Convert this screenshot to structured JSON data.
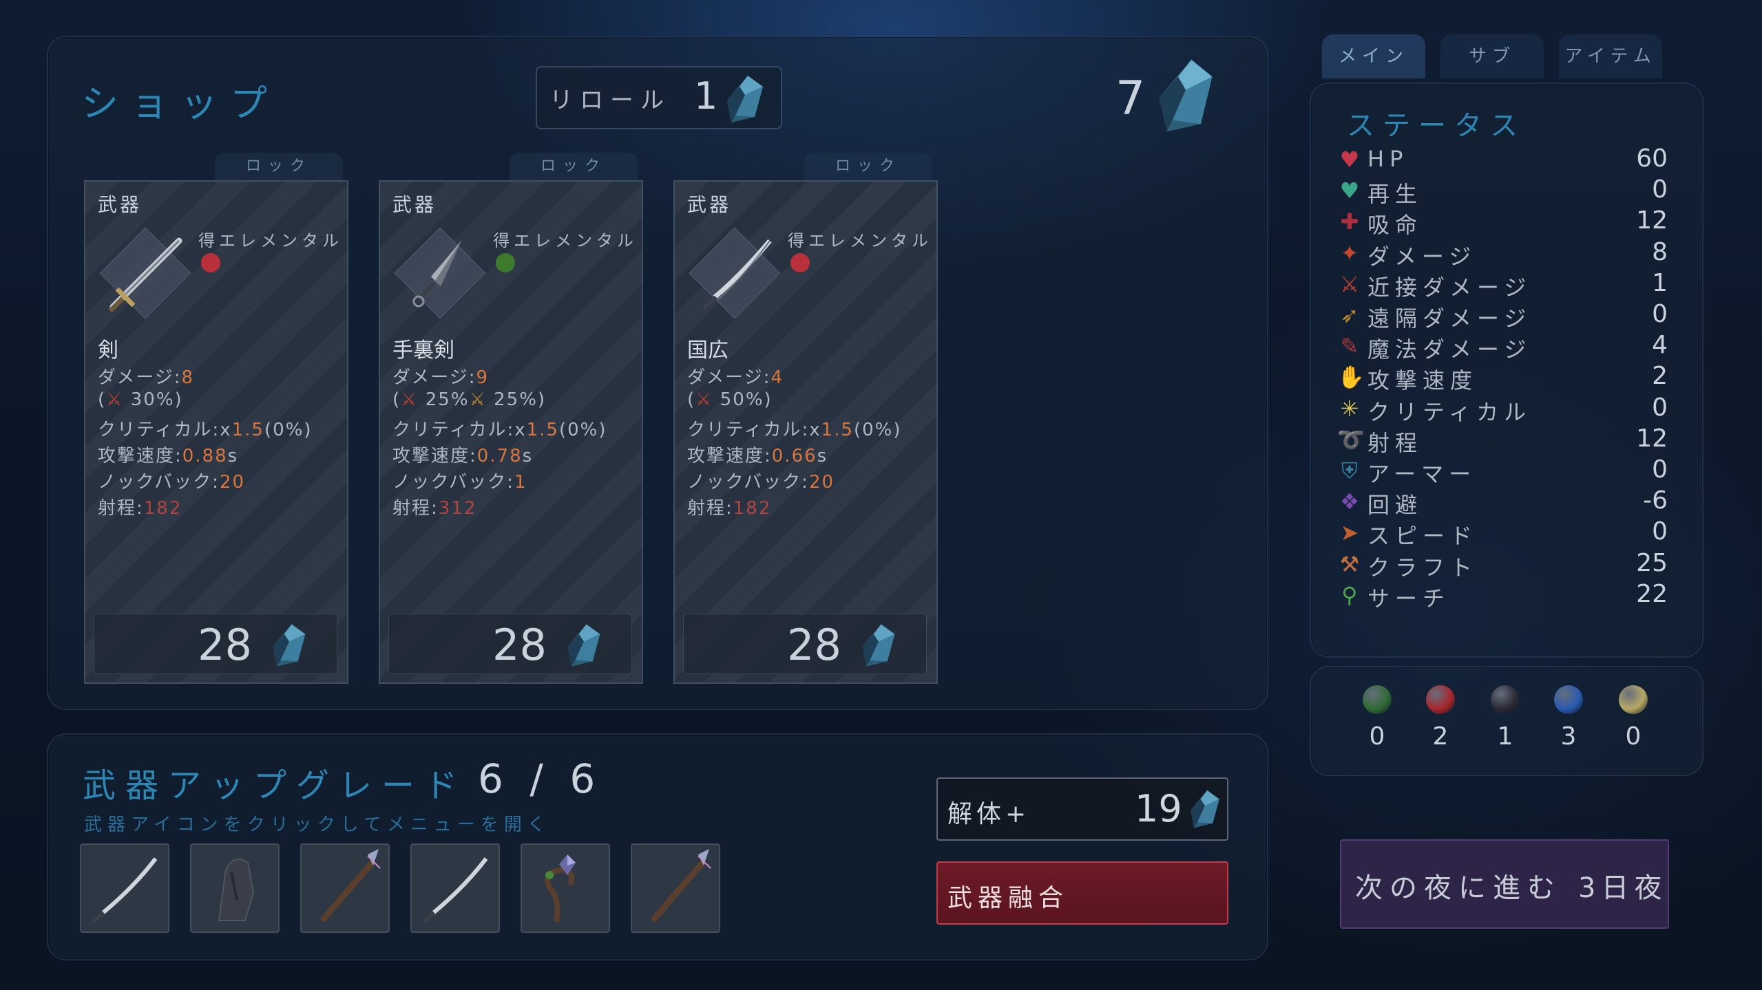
{
  "shop": {
    "title": "ショップ",
    "reroll_label": "リロール",
    "reroll_cost": "1",
    "money": "7"
  },
  "cards": [
    {
      "lock": "ロック",
      "category": "武器",
      "element_label": "得エレメンタル",
      "element_color": "#b8313a",
      "name": "剣",
      "damage_label": "ダメージ:",
      "damage": "8",
      "scaling_open": "(",
      "scaling": " 30%)",
      "crit_label": "クリティカル:",
      "crit_x": "x",
      "crit_mult": "1.5",
      "crit_pct": "(0%)",
      "speed_label": "攻撃速度:",
      "speed": "0.88",
      "speed_unit": "s",
      "knockback_label": "ノックバック:",
      "knockback": "20",
      "range_label": "射程:",
      "range": "182",
      "price": "28"
    },
    {
      "lock": "ロック",
      "category": "武器",
      "element_label": "得エレメンタル",
      "element_color": "#3c7a2e",
      "name": "手裏剣",
      "damage_label": "ダメージ:",
      "damage": "9",
      "scaling_open": "(",
      "scaling": " 25%",
      "scaling2": " 25%)",
      "crit_label": "クリティカル:",
      "crit_x": "x",
      "crit_mult": "1.5",
      "crit_pct": "(0%)",
      "speed_label": "攻撃速度:",
      "speed": "0.78",
      "speed_unit": "s",
      "knockback_label": "ノックバック:",
      "knockback": "1",
      "range_label": "射程:",
      "range": "312",
      "price": "28"
    },
    {
      "lock": "ロック",
      "category": "武器",
      "element_label": "得エレメンタル",
      "element_color": "#b8313a",
      "name": "国広",
      "damage_label": "ダメージ:",
      "damage": "4",
      "scaling_open": "(",
      "scaling": " 50%)",
      "crit_label": "クリティカル:",
      "crit_x": "x",
      "crit_mult": "1.5",
      "crit_pct": "(0%)",
      "speed_label": "攻撃速度:",
      "speed": "0.66",
      "speed_unit": "s",
      "knockback_label": "ノックバック:",
      "knockback": "20",
      "range_label": "射程:",
      "range": "182",
      "price": "28"
    }
  ],
  "tabs": [
    "メイン",
    "サブ",
    "アイテム"
  ],
  "status": {
    "title": "ステータス",
    "rows": [
      {
        "icon": "heart-icon",
        "label": "HP",
        "value": "60"
      },
      {
        "icon": "regen-heart-icon",
        "label": "再生",
        "value": "0"
      },
      {
        "icon": "lifesteal-icon",
        "label": "吸命",
        "value": "12"
      },
      {
        "icon": "damage-icon",
        "label": "ダメージ",
        "value": "8"
      },
      {
        "icon": "melee-damage-icon",
        "label": "近接ダメージ",
        "value": "1"
      },
      {
        "icon": "ranged-damage-icon",
        "label": "遠隔ダメージ",
        "value": "0"
      },
      {
        "icon": "magic-damage-icon",
        "label": "魔法ダメージ",
        "value": "4"
      },
      {
        "icon": "attack-speed-icon",
        "label": "攻撃速度",
        "value": "2"
      },
      {
        "icon": "critical-icon",
        "label": "クリティカル",
        "value": "0"
      },
      {
        "icon": "range-icon",
        "label": "射程",
        "value": "12"
      },
      {
        "icon": "armor-icon",
        "label": "アーマー",
        "value": "0"
      },
      {
        "icon": "dodge-icon",
        "label": "回避",
        "value": "-6"
      },
      {
        "icon": "speed-icon",
        "label": "スピード",
        "value": "0"
      },
      {
        "icon": "craft-icon",
        "label": "クラフト",
        "value": "25"
      },
      {
        "icon": "search-icon",
        "label": "サーチ",
        "value": "22"
      }
    ],
    "colors": {
      "heart-icon": "#c7374a",
      "regen-heart-icon": "#3aa58a",
      "lifesteal-icon": "#b02f3f",
      "damage-icon": "#c2472e",
      "melee-damage-icon": "#b8402e",
      "ranged-damage-icon": "#b8862e",
      "magic-damage-icon": "#a8383a",
      "attack-speed-icon": "#4a7ab8",
      "critical-icon": "#d8c35a",
      "range-icon": "#3a5fa0",
      "armor-icon": "#3a7fa0",
      "dodge-icon": "#7a4ab0",
      "speed-icon": "#c0602e",
      "craft-icon": "#c0703e",
      "search-icon": "#4ea64a"
    }
  },
  "elements": [
    {
      "color": "#2f6a34",
      "count": "0"
    },
    {
      "color": "#a8262e",
      "count": "2"
    },
    {
      "color": "#2a2a36",
      "count": "1"
    },
    {
      "color": "#2a5ab0",
      "count": "3"
    },
    {
      "color": "#b8a866",
      "count": "0"
    }
  ],
  "upgrade": {
    "title": "武器アップグレード",
    "count": "6 / 6",
    "hint": "武器アイコンをクリックしてメニューを開く",
    "slots": [
      "katana-icon",
      "dark-blade-icon",
      "spear-icon",
      "katana-icon",
      "staff-icon",
      "spear-icon"
    ]
  },
  "actions": {
    "dismantle_label": "解体+",
    "dismantle_value": "19",
    "fusion_label": "武器融合",
    "next_night_label": "次の夜に進む",
    "next_night_day": "3日夜"
  }
}
